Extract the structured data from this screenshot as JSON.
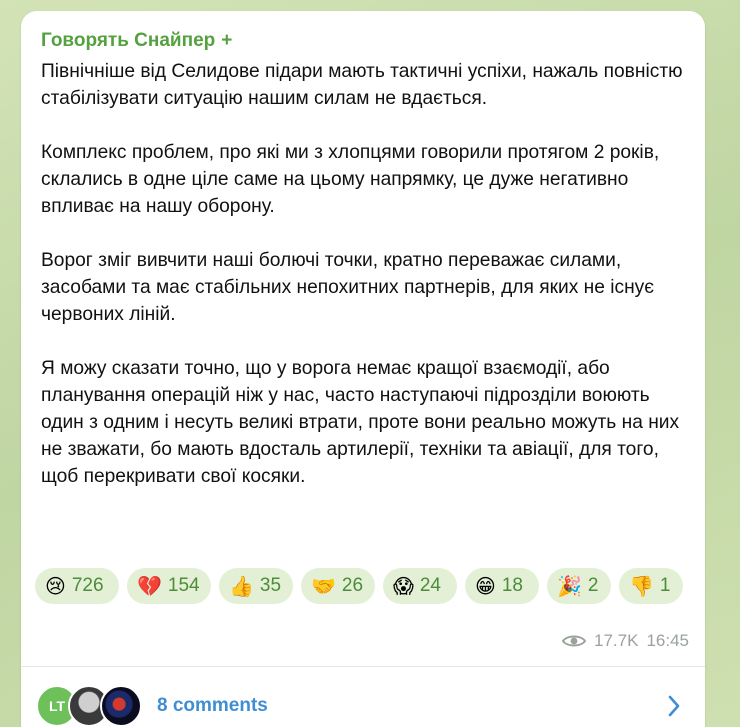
{
  "post": {
    "author": "Говорять Снайпер",
    "author_badge": "+",
    "paragraphs": [
      "Північніше від Селидове підари мають тактичні успіхи, нажаль повністю стабілізувати ситуацію нашим силам не вдається.",
      "Комплекс проблем, про які ми з хлопцями говорили протягом 2 років, склались в одне ціле саме на цьому напрямку, це дуже негативно впливає на нашу оборону.",
      "Ворог зміг вивчити наші болючі точки, кратно переважає силами, засобами та має стабільних непохитних партнерів, для яких не існує червоних ліній.",
      "Я можу сказати точно, що у ворога немає кращої взаємодії, або планування операцій ніж у нас, часто наступаючі підрозділи воюють один з одним і несуть великі втрати, проте вони реально можуть на них не зважати, бо мають вдосталь артилерії, техніки та авіації, для того, щоб перекривати свої косяки."
    ],
    "reactions": [
      {
        "emoji": "😢",
        "icon": "crying-face-icon",
        "count": "726"
      },
      {
        "emoji": "💔",
        "icon": "broken-heart-icon",
        "count": "154"
      },
      {
        "emoji": "👍",
        "icon": "thumbs-up-icon",
        "count": "35"
      },
      {
        "emoji": "🤝",
        "icon": "pointing-hand-icon",
        "count": "26"
      },
      {
        "emoji": "😱",
        "icon": "screaming-face-icon",
        "count": "24"
      },
      {
        "emoji": "😁",
        "icon": "grinning-face-icon",
        "count": "18"
      },
      {
        "emoji": "🎉",
        "icon": "party-popper-icon",
        "count": "2"
      },
      {
        "emoji": "👎",
        "icon": "thumbs-down-icon",
        "count": "1"
      }
    ],
    "views": "17.7K",
    "time": "16:45",
    "comments": {
      "label": "8 comments",
      "avatar_initials": "LT"
    },
    "colors": {
      "author": "#55a13f",
      "reaction_bg": "#e3f0d6",
      "reaction_count": "#4d8c3a",
      "comments_link": "#3f8ed4",
      "meta": "#9aa39a",
      "background": "#c9dcae"
    }
  }
}
